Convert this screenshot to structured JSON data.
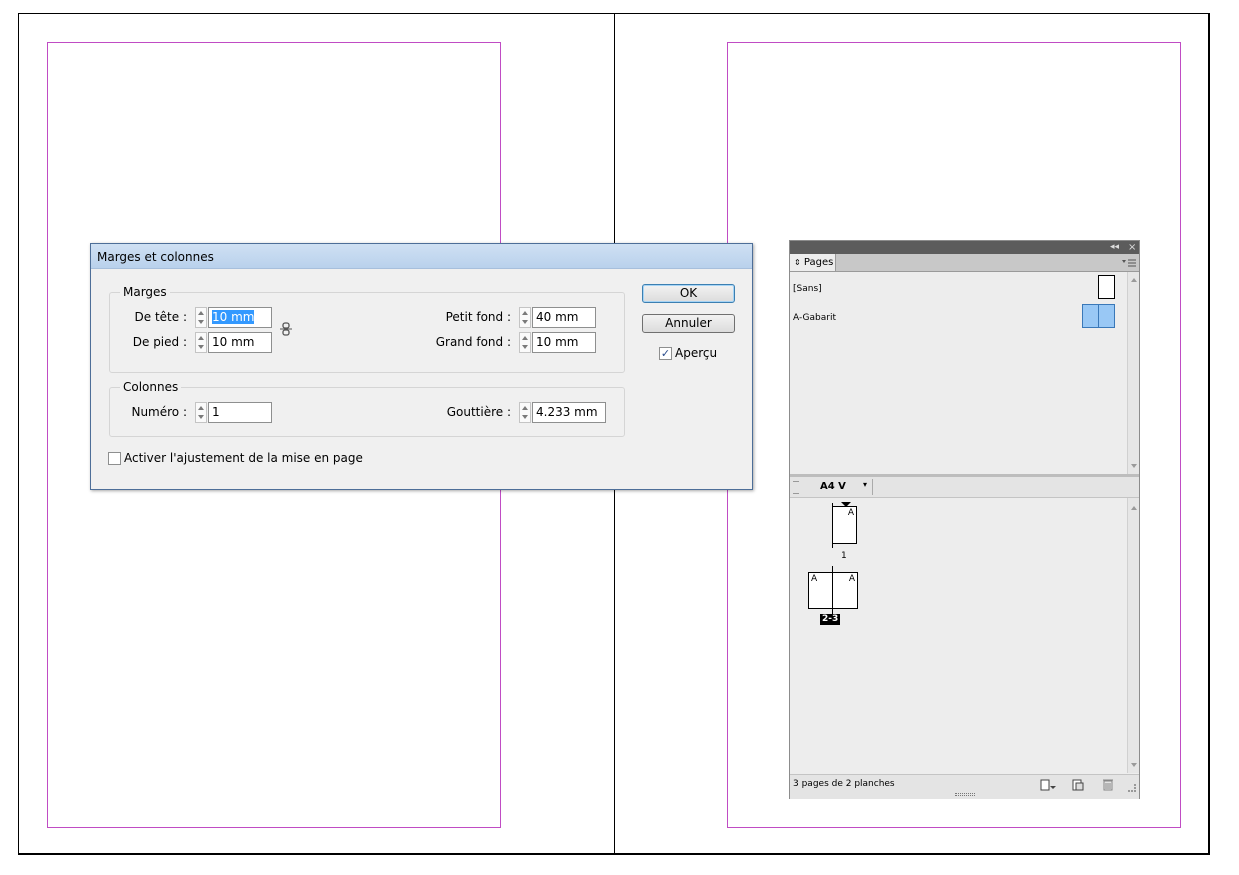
{
  "document": {
    "margin_color": "#c04cc4"
  },
  "dialog": {
    "title": "Marges et colonnes",
    "margins_group": {
      "legend": "Marges",
      "top_label": "De tête :",
      "top_value": "10 mm",
      "bottom_label": "De pied :",
      "bottom_value": "10 mm",
      "inside_label": "Petit fond :",
      "inside_value": "40 mm",
      "outside_label": "Grand fond :",
      "outside_value": "10 mm"
    },
    "columns_group": {
      "legend": "Colonnes",
      "number_label": "Numéro :",
      "number_value": "1",
      "gutter_label": "Gouttière :",
      "gutter_value": "4.233 mm"
    },
    "layout_adjust_label": "Activer l'ajustement de la mise en page",
    "layout_adjust_checked": false,
    "ok_label": "OK",
    "cancel_label": "Annuler",
    "preview_label": "Aperçu",
    "preview_checked": true
  },
  "pages_panel": {
    "tab_label": "Pages",
    "masters": [
      {
        "name": "[Sans]"
      },
      {
        "name": "A-Gabarit"
      }
    ],
    "page_size": "A4 V",
    "pages": {
      "page1_label": "1",
      "page1_master": "A",
      "spread_label": "2-3",
      "spread_left_master": "A",
      "spread_right_master": "A"
    },
    "status": "3 pages de 2 planches",
    "selection_color": "#99c8f5"
  }
}
